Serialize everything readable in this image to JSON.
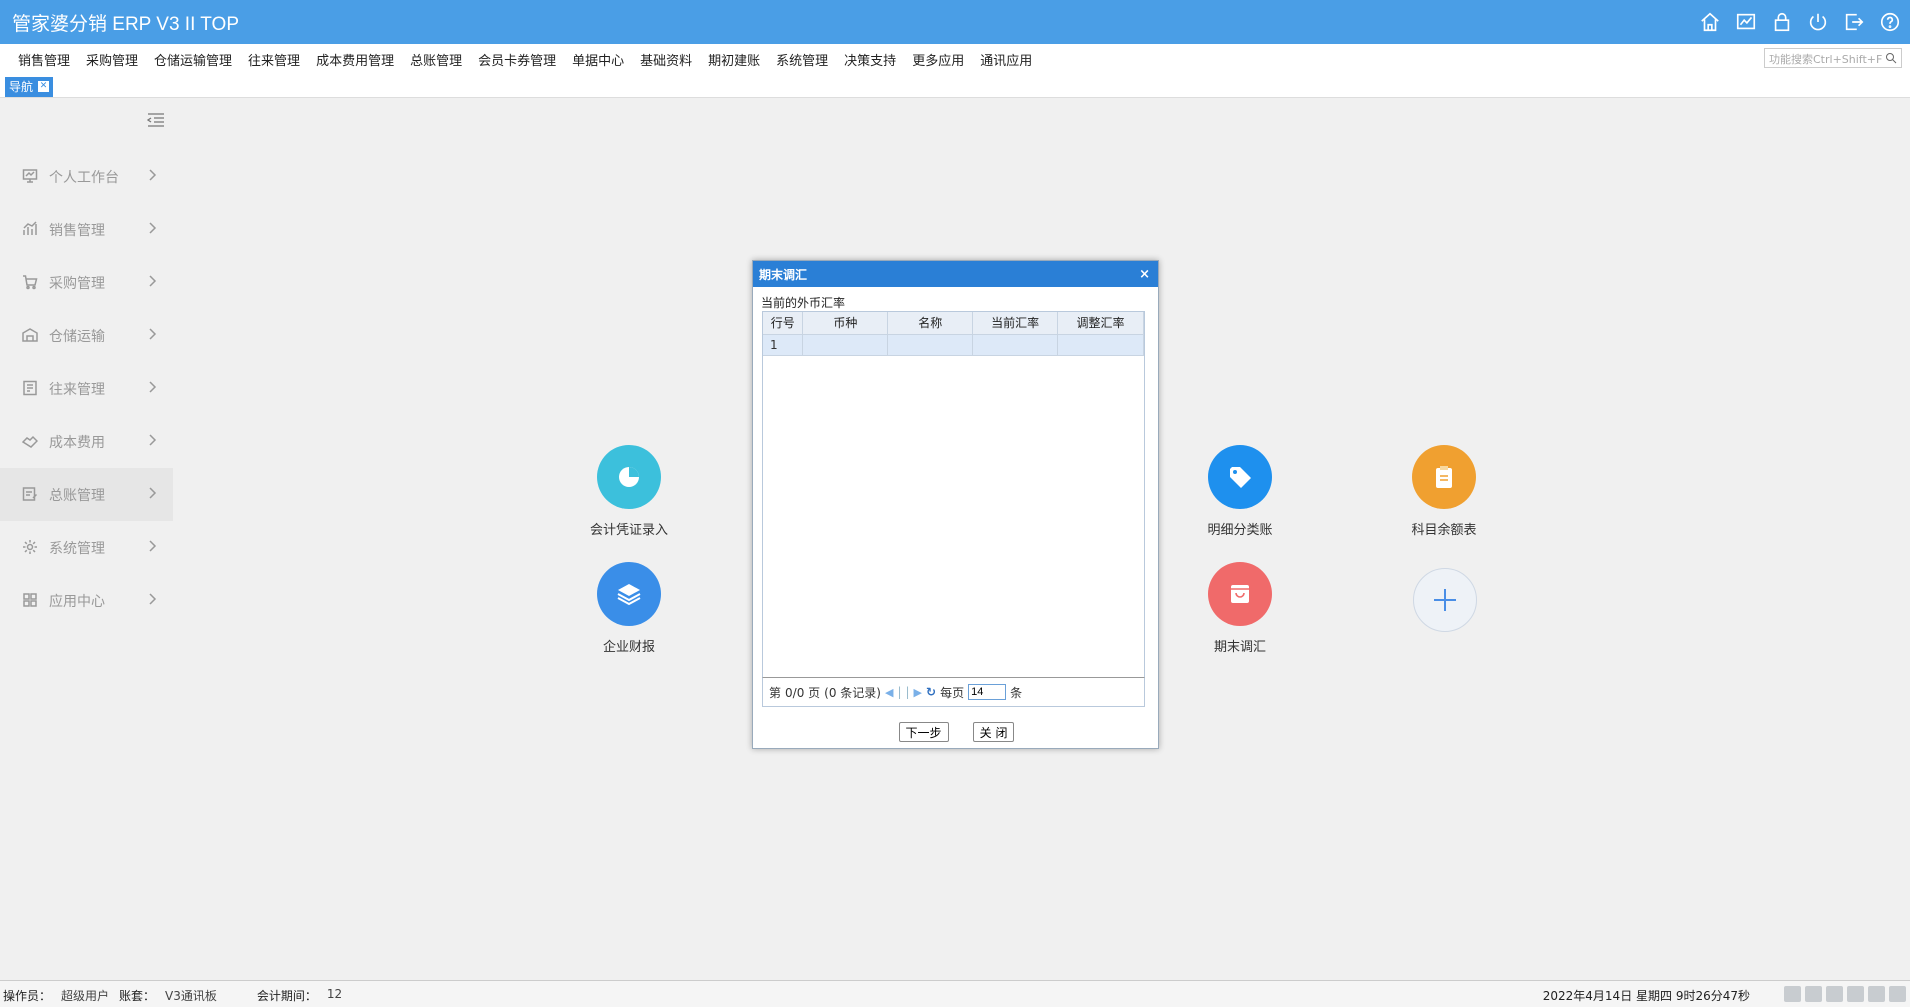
{
  "app": {
    "title": "管家婆分销 ERP V3 II TOP"
  },
  "header_icons": [
    "home-icon",
    "chart-icon",
    "lock-icon",
    "power-icon",
    "logout-icon",
    "help-icon"
  ],
  "menu": {
    "items": [
      "销售管理",
      "采购管理",
      "仓储运输管理",
      "往来管理",
      "成本费用管理",
      "总账管理",
      "会员卡券管理",
      "单据中心",
      "基础资料",
      "期初建账",
      "系统管理",
      "决策支持",
      "更多应用",
      "通讯应用"
    ],
    "search_placeholder": "功能搜索Ctrl+Shift+F"
  },
  "tabs": [
    {
      "label": "导航"
    }
  ],
  "sidebar": {
    "items": [
      {
        "label": "个人工作台",
        "icon": "monitor-icon"
      },
      {
        "label": "销售管理",
        "icon": "bar-chart-icon"
      },
      {
        "label": "采购管理",
        "icon": "cart-icon"
      },
      {
        "label": "仓储运输",
        "icon": "warehouse-icon"
      },
      {
        "label": "往来管理",
        "icon": "document-icon"
      },
      {
        "label": "成本费用",
        "icon": "handshake-icon"
      },
      {
        "label": "总账管理",
        "icon": "ledger-icon"
      },
      {
        "label": "系统管理",
        "icon": "gear-icon"
      },
      {
        "label": "应用中心",
        "icon": "grid-icon"
      }
    ]
  },
  "shortcuts": [
    {
      "label": "会计凭证录入",
      "color": "#3cc0dc"
    },
    {
      "label": "企业财报",
      "color": "#3a8ee8"
    },
    {
      "label": "明细分类账",
      "color": "#1e90ee"
    },
    {
      "label": "科目余额表",
      "color": "#f0a030"
    },
    {
      "label": "期末调汇",
      "color": "#f06a6a"
    }
  ],
  "dialog": {
    "title": "期末调汇",
    "close": "×",
    "subtitle": "当前的外币汇率",
    "columns": [
      "行号",
      "币种",
      "名称",
      "当前汇率",
      "调整汇率"
    ],
    "rows": [
      [
        "1",
        "",
        "",
        "",
        ""
      ]
    ],
    "pager": {
      "page_prefix": "第",
      "page_text": "0/0 页",
      "records": "(0 条记录)",
      "per_page_label": "每页",
      "per_page_value": "14",
      "unit": "条"
    },
    "next_button": "下一步",
    "close_button": "关 闭"
  },
  "status": {
    "operator_label": "操作员：",
    "operator": "超级用户",
    "account_label": "账套：",
    "account": "V3通讯板",
    "period_label": "会计期间：",
    "period": "12",
    "datetime": "2022年4月14日 星期四 9时26分47秒"
  }
}
